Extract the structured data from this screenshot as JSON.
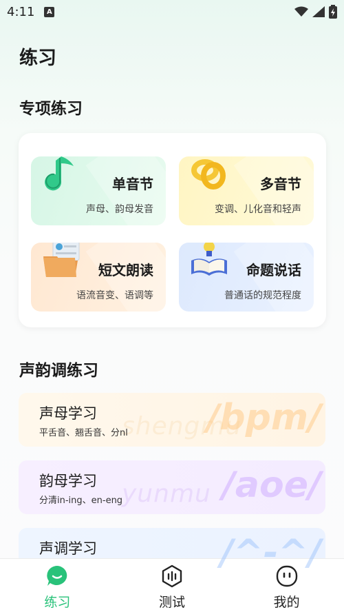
{
  "status_bar": {
    "time": "4:11",
    "notification_icon": "a-badge-icon",
    "icons": [
      "wifi-icon",
      "signal-icon",
      "battery-icon"
    ]
  },
  "page": {
    "title": "练习"
  },
  "special": {
    "section_title": "专项练习",
    "tiles": [
      {
        "title": "单音节",
        "subtitle": "声母、韵母发音",
        "icon": "music-note-icon"
      },
      {
        "title": "多音节",
        "subtitle": "变调、儿化音和轻声",
        "icon": "knot-icon"
      },
      {
        "title": "短文朗读",
        "subtitle": "语流音变、语调等",
        "icon": "folder-document-icon"
      },
      {
        "title": "命题说话",
        "subtitle": "普通话的规范程度",
        "icon": "book-bulb-icon"
      }
    ]
  },
  "tones": {
    "section_title": "声韵调练习",
    "items": [
      {
        "title": "声母学习",
        "subtitle": "平舌音、翘舌音、分nl",
        "bg_word": "shengmu",
        "big_text": "/bpm/"
      },
      {
        "title": "韵母学习",
        "subtitle": "分清in-ing、en-eng",
        "bg_word": "yunmu",
        "big_text": "/aoe/"
      },
      {
        "title": "声调学习",
        "subtitle": "",
        "bg_word": "",
        "big_text": "/^-^/"
      }
    ]
  },
  "tabbar": {
    "tabs": [
      {
        "label": "练习",
        "icon": "chat-bubble-icon",
        "active": true
      },
      {
        "label": "测试",
        "icon": "hexagon-sound-icon",
        "active": false
      },
      {
        "label": "我的",
        "icon": "face-icon",
        "active": false
      }
    ]
  },
  "colors": {
    "accent": "#29c27a",
    "text": "#1b1b1b"
  }
}
